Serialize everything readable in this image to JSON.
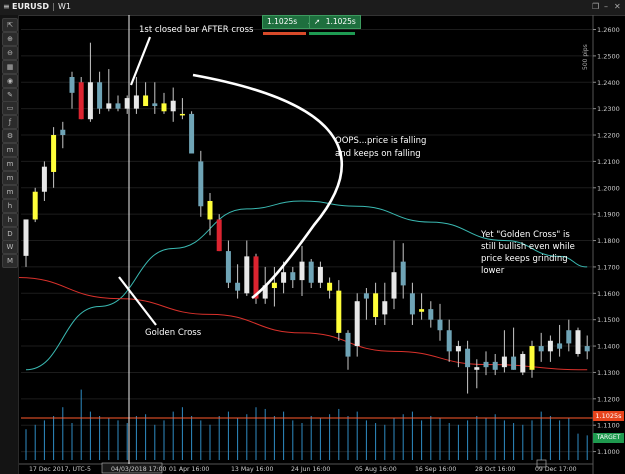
{
  "window": {
    "symbol": "EURUSD",
    "timeframe": "W1",
    "sell_price": "1.1025s",
    "buy_price": "1.1025s",
    "side_label": "500 pips"
  },
  "toolbar": {
    "buttons": [
      {
        "name": "cursor-tool-button",
        "glyph": "⇱"
      },
      {
        "name": "zoom-in-button",
        "glyph": "⊕"
      },
      {
        "name": "zoom-out-button",
        "glyph": "⊖"
      },
      {
        "name": "chart-type-button",
        "glyph": "▦"
      },
      {
        "name": "globe-button",
        "glyph": "◉"
      },
      {
        "name": "draw-button",
        "glyph": "✎"
      },
      {
        "name": "screen-button",
        "glyph": "▭"
      },
      {
        "name": "indicator-button",
        "glyph": "ƒ"
      },
      {
        "name": "tools-button",
        "glyph": "⚙"
      },
      {
        "name": "tf-m1-button",
        "glyph": "m"
      },
      {
        "name": "tf-m5-button",
        "glyph": "m"
      },
      {
        "name": "tf-m15-button",
        "glyph": "m"
      },
      {
        "name": "tf-m30-button",
        "glyph": "m"
      },
      {
        "name": "tf-h1-button",
        "glyph": "h"
      },
      {
        "name": "tf-h4-button",
        "glyph": "h"
      },
      {
        "name": "tf-d1-button",
        "glyph": "D"
      },
      {
        "name": "tf-w1-button",
        "glyph": "W"
      },
      {
        "name": "tf-mn-button",
        "glyph": "M"
      }
    ]
  },
  "chart_data": {
    "type": "candlestick",
    "y_ticks": [
      "1.2600",
      "1.2500",
      "1.2400",
      "1.2300",
      "1.2200",
      "1.2100",
      "1.2000",
      "1.1900",
      "1.1800",
      "1.1700",
      "1.1600",
      "1.1500",
      "1.1400",
      "1.1300",
      "1.1200",
      "1.1100",
      "1.1000"
    ],
    "ylim": [
      1.0915,
      1.2655
    ],
    "x_labels": [
      "17 Dec 2017, UTC-5",
      "04/03/2018 17:00",
      "01 Apr 16:00",
      "13 May 16:00",
      "24 Jun 16:00",
      "05 Aug 16:00",
      "16 Sep 16:00",
      "28 Oct 16:00",
      "09 Dec 17:00"
    ],
    "candles": [
      {
        "o": 1.1742,
        "h": 1.183,
        "l": 1.17,
        "c": 1.188,
        "color": "white"
      },
      {
        "o": 1.188,
        "h": 1.2,
        "l": 1.187,
        "c": 1.1985,
        "color": "yellow"
      },
      {
        "o": 1.1985,
        "h": 1.21,
        "l": 1.195,
        "c": 1.208,
        "color": "white"
      },
      {
        "o": 1.206,
        "h": 1.223,
        "l": 1.2,
        "c": 1.22,
        "color": "yellow"
      },
      {
        "o": 1.22,
        "h": 1.225,
        "l": 1.215,
        "c": 1.222,
        "color": "teal"
      },
      {
        "o": 1.236,
        "h": 1.244,
        "l": 1.23,
        "c": 1.242,
        "color": "teal"
      },
      {
        "o": 1.24,
        "h": 1.242,
        "l": 1.226,
        "c": 1.226,
        "color": "red"
      },
      {
        "o": 1.226,
        "h": 1.255,
        "l": 1.225,
        "c": 1.24,
        "color": "white"
      },
      {
        "o": 1.24,
        "h": 1.244,
        "l": 1.228,
        "c": 1.23,
        "color": "teal"
      },
      {
        "o": 1.23,
        "h": 1.245,
        "l": 1.229,
        "c": 1.232,
        "color": "white"
      },
      {
        "o": 1.232,
        "h": 1.235,
        "l": 1.229,
        "c": 1.23,
        "color": "teal"
      },
      {
        "o": 1.23,
        "h": 1.235,
        "l": 1.228,
        "c": 1.234,
        "color": "white"
      },
      {
        "o": 1.23,
        "h": 1.242,
        "l": 1.228,
        "c": 1.235,
        "color": "white"
      },
      {
        "o": 1.235,
        "h": 1.24,
        "l": 1.231,
        "c": 1.231,
        "color": "yellow"
      },
      {
        "o": 1.231,
        "h": 1.24,
        "l": 1.228,
        "c": 1.232,
        "color": "teal"
      },
      {
        "o": 1.232,
        "h": 1.236,
        "l": 1.228,
        "c": 1.229,
        "color": "yellow"
      },
      {
        "o": 1.229,
        "h": 1.238,
        "l": 1.225,
        "c": 1.233,
        "color": "white"
      },
      {
        "o": 1.228,
        "h": 1.234,
        "l": 1.226,
        "c": 1.228,
        "color": "yellow"
      },
      {
        "o": 1.228,
        "h": 1.229,
        "l": 1.213,
        "c": 1.213,
        "color": "teal"
      },
      {
        "o": 1.21,
        "h": 1.214,
        "l": 1.189,
        "c": 1.193,
        "color": "teal"
      },
      {
        "o": 1.195,
        "h": 1.198,
        "l": 1.182,
        "c": 1.188,
        "color": "yellow"
      },
      {
        "o": 1.188,
        "h": 1.19,
        "l": 1.176,
        "c": 1.176,
        "color": "red"
      },
      {
        "o": 1.176,
        "h": 1.18,
        "l": 1.162,
        "c": 1.164,
        "color": "teal"
      },
      {
        "o": 1.164,
        "h": 1.171,
        "l": 1.158,
        "c": 1.161,
        "color": "teal"
      },
      {
        "o": 1.16,
        "h": 1.18,
        "l": 1.159,
        "c": 1.174,
        "color": "white"
      },
      {
        "o": 1.174,
        "h": 1.175,
        "l": 1.156,
        "c": 1.158,
        "color": "red"
      },
      {
        "o": 1.158,
        "h": 1.17,
        "l": 1.156,
        "c": 1.163,
        "color": "white"
      },
      {
        "o": 1.162,
        "h": 1.17,
        "l": 1.155,
        "c": 1.164,
        "color": "yellow"
      },
      {
        "o": 1.164,
        "h": 1.172,
        "l": 1.16,
        "c": 1.168,
        "color": "white"
      },
      {
        "o": 1.168,
        "h": 1.17,
        "l": 1.162,
        "c": 1.165,
        "color": "teal"
      },
      {
        "o": 1.165,
        "h": 1.178,
        "l": 1.159,
        "c": 1.172,
        "color": "white"
      },
      {
        "o": 1.172,
        "h": 1.173,
        "l": 1.162,
        "c": 1.164,
        "color": "teal"
      },
      {
        "o": 1.164,
        "h": 1.172,
        "l": 1.162,
        "c": 1.17,
        "color": "white"
      },
      {
        "o": 1.161,
        "h": 1.166,
        "l": 1.158,
        "c": 1.164,
        "color": "yellow"
      },
      {
        "o": 1.161,
        "h": 1.165,
        "l": 1.142,
        "c": 1.145,
        "color": "yellow"
      },
      {
        "o": 1.145,
        "h": 1.146,
        "l": 1.131,
        "c": 1.136,
        "color": "teal"
      },
      {
        "o": 1.14,
        "h": 1.16,
        "l": 1.136,
        "c": 1.157,
        "color": "white"
      },
      {
        "o": 1.158,
        "h": 1.162,
        "l": 1.15,
        "c": 1.16,
        "color": "teal"
      },
      {
        "o": 1.16,
        "h": 1.164,
        "l": 1.148,
        "c": 1.151,
        "color": "yellow"
      },
      {
        "o": 1.152,
        "h": 1.164,
        "l": 1.148,
        "c": 1.157,
        "color": "white"
      },
      {
        "o": 1.158,
        "h": 1.18,
        "l": 1.154,
        "c": 1.168,
        "color": "white"
      },
      {
        "o": 1.172,
        "h": 1.179,
        "l": 1.158,
        "c": 1.163,
        "color": "teal"
      },
      {
        "o": 1.16,
        "h": 1.164,
        "l": 1.148,
        "c": 1.152,
        "color": "teal"
      },
      {
        "o": 1.154,
        "h": 1.16,
        "l": 1.15,
        "c": 1.153,
        "color": "yellow"
      },
      {
        "o": 1.154,
        "h": 1.157,
        "l": 1.147,
        "c": 1.15,
        "color": "teal"
      },
      {
        "o": 1.15,
        "h": 1.156,
        "l": 1.142,
        "c": 1.146,
        "color": "teal"
      },
      {
        "o": 1.146,
        "h": 1.15,
        "l": 1.134,
        "c": 1.138,
        "color": "teal"
      },
      {
        "o": 1.138,
        "h": 1.142,
        "l": 1.132,
        "c": 1.14,
        "color": "white"
      },
      {
        "o": 1.139,
        "h": 1.142,
        "l": 1.122,
        "c": 1.132,
        "color": "teal"
      },
      {
        "o": 1.132,
        "h": 1.135,
        "l": 1.124,
        "c": 1.131,
        "color": "white"
      },
      {
        "o": 1.134,
        "h": 1.138,
        "l": 1.129,
        "c": 1.132,
        "color": "teal"
      },
      {
        "o": 1.134,
        "h": 1.137,
        "l": 1.129,
        "c": 1.131,
        "color": "teal"
      },
      {
        "o": 1.132,
        "h": 1.146,
        "l": 1.13,
        "c": 1.136,
        "color": "white"
      },
      {
        "o": 1.136,
        "h": 1.147,
        "l": 1.132,
        "c": 1.131,
        "color": "teal"
      },
      {
        "o": 1.13,
        "h": 1.138,
        "l": 1.129,
        "c": 1.137,
        "color": "white"
      },
      {
        "o": 1.131,
        "h": 1.142,
        "l": 1.128,
        "c": 1.14,
        "color": "yellow"
      },
      {
        "o": 1.14,
        "h": 1.145,
        "l": 1.134,
        "c": 1.138,
        "color": "teal"
      },
      {
        "o": 1.138,
        "h": 1.144,
        "l": 1.134,
        "c": 1.142,
        "color": "white"
      },
      {
        "o": 1.139,
        "h": 1.148,
        "l": 1.136,
        "c": 1.141,
        "color": "teal"
      },
      {
        "o": 1.141,
        "h": 1.15,
        "l": 1.138,
        "c": 1.146,
        "color": "teal"
      },
      {
        "o": 1.146,
        "h": 1.147,
        "l": 1.136,
        "c": 1.137,
        "color": "white"
      },
      {
        "o": 1.138,
        "h": 1.144,
        "l": 1.135,
        "c": 1.14,
        "color": "teal"
      }
    ],
    "ma_fast": [
      [
        0,
        1.131
      ],
      [
        8,
        1.155
      ],
      [
        16,
        1.177
      ],
      [
        24,
        1.192
      ],
      [
        30,
        1.195
      ],
      [
        36,
        1.193
      ],
      [
        44,
        1.187
      ],
      [
        52,
        1.18
      ],
      [
        58,
        1.174
      ],
      [
        61,
        1.17
      ]
    ],
    "ma_slow": [
      [
        -1,
        1.166
      ],
      [
        10,
        1.158
      ],
      [
        20,
        1.152
      ],
      [
        30,
        1.145
      ],
      [
        40,
        1.138
      ],
      [
        50,
        1.133
      ],
      [
        61,
        1.131
      ]
    ],
    "volume": [
      0.35,
      0.4,
      0.45,
      0.5,
      0.6,
      0.42,
      0.8,
      0.55,
      0.5,
      0.48,
      0.45,
      0.42,
      0.5,
      0.52,
      0.4,
      0.45,
      0.55,
      0.6,
      0.5,
      0.45,
      0.4,
      0.5,
      0.55,
      0.48,
      0.52,
      0.6,
      0.58,
      0.5,
      0.55,
      0.45,
      0.42,
      0.5,
      0.48,
      0.52,
      0.58,
      0.5,
      0.55,
      0.45,
      0.42,
      0.4,
      0.48,
      0.52,
      0.55,
      0.45,
      0.5,
      0.48,
      0.42,
      0.4,
      0.45,
      0.5,
      0.48,
      0.52,
      0.45,
      0.42,
      0.4,
      0.45,
      0.55,
      0.5,
      0.45,
      0.48,
      0.3,
      0.28
    ],
    "current_price_tag": "1.1025s",
    "target_tag": "TARGET",
    "cursor_date_label": "04/03/2018 17:00",
    "annotations": [
      {
        "text": "1st closed bar AFTER cross"
      },
      {
        "text": "OOPS...price is falling and keeps on falling"
      },
      {
        "text": "Yet \"Golden Cross\" is still bullish even while price keeps grinding lower"
      },
      {
        "text": "Golden Cross"
      }
    ],
    "colors": {
      "bull_white": "#e8e8e8",
      "bull_yellow": "#ffff3a",
      "bear_teal": "#6fa4b6",
      "bear_red": "#dc2430",
      "ma_fast": "#3ab9b2",
      "ma_slow": "#d9312b",
      "volume": "#2f8cc4",
      "hline": "#ff5a2d",
      "target": "#24a65a",
      "grid": "#1c1c1c"
    }
  }
}
